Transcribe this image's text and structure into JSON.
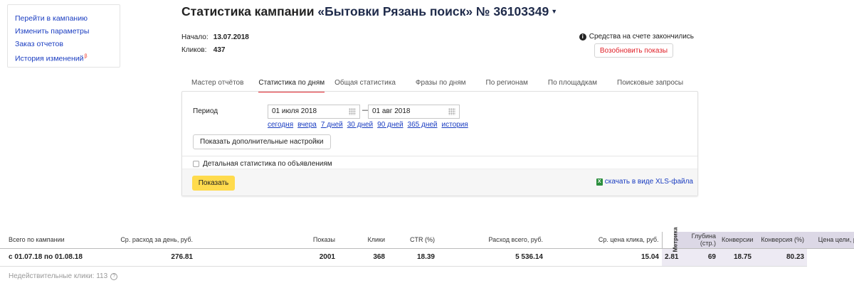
{
  "sidebar": {
    "items": [
      {
        "label": "Перейти в кампанию"
      },
      {
        "label": "Изменить параметры"
      },
      {
        "label": "Заказ отчетов"
      },
      {
        "label": "История изменений",
        "badge": "β"
      }
    ]
  },
  "header": {
    "title_prefix": "Статистика кампании",
    "campaign": "«Бытовки Рязань поиск» № 36103349",
    "dropdown_icon": "triangle-down-icon"
  },
  "info": {
    "start_label": "Начало:",
    "start_value": "13.07.2018",
    "clicks_label": "Кликов:",
    "clicks_value": "437"
  },
  "funds": {
    "message": "Средства на счете закончились",
    "resume_button": "Возобновить показы",
    "accent": "#e0222a"
  },
  "tabs": [
    {
      "label": "Мастер отчётов",
      "active": false
    },
    {
      "label": "Статистика по дням",
      "active": true
    },
    {
      "label": "Общая статистика",
      "active": false
    },
    {
      "label": "Фразы по дням",
      "active": false
    },
    {
      "label": "По регионам",
      "active": false
    },
    {
      "label": "По площадкам",
      "active": false
    },
    {
      "label": "Поисковые запросы",
      "active": false
    }
  ],
  "panel": {
    "period_label": "Период",
    "date_from": "01 июля 2018",
    "date_to": "01 авг 2018",
    "dash": "—",
    "quick_links": [
      "сегодня",
      "вчера",
      "7 дней",
      "30 дней",
      "90 дней",
      "365 дней",
      "история"
    ],
    "more_settings": "Показать дополнительные настройки",
    "detailed_checkbox": "Детальная статистика по объявлениям",
    "detailed_checked": false,
    "show_button": "Показать",
    "show_button_color": "#ffdb4d",
    "xls_link": "скачать в виде XLS-файла"
  },
  "table": {
    "headers": [
      "Всего по кампании",
      "Ср. расход за день, руб.",
      "Показы",
      "Клики",
      "CTR (%)",
      "Расход всего, руб.",
      "Ср. цена клика, руб.",
      "Метрика",
      "Глубина (стр.)",
      "Конверсии",
      "Конверсия (%)",
      "Цена цели, руб."
    ],
    "row": [
      "с 01.07.18 по 01.08.18",
      "276.81",
      "2001",
      "368",
      "18.39",
      "5 536.14",
      "15.04",
      "",
      "2.81",
      "69",
      "18.75",
      "80.23"
    ]
  },
  "invalid_clicks": "Недействительные клики: 113"
}
